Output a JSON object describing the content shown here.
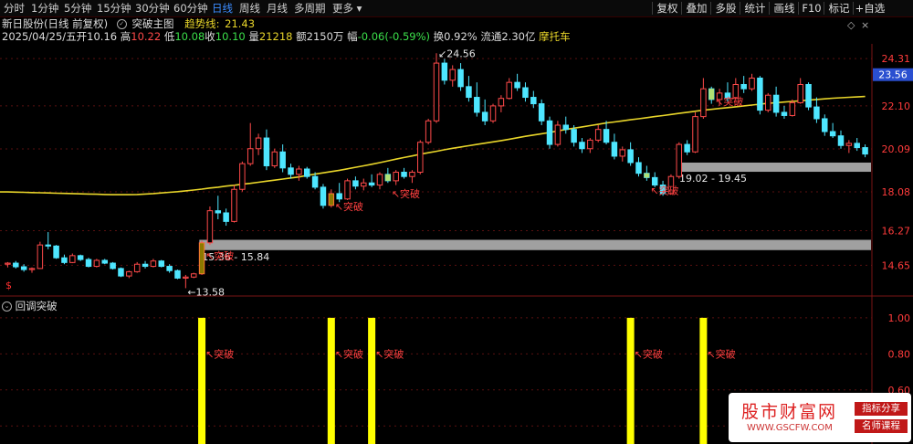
{
  "toolbar": {
    "periods": [
      "分时",
      "1分钟",
      "5分钟",
      "15分钟",
      "30分钟",
      "60分钟",
      "日线",
      "周线",
      "月线",
      "多周期",
      "更多"
    ],
    "active_period": "日线",
    "right_buttons": [
      "复权",
      "叠加",
      "多股",
      "统计",
      "画线",
      "F10",
      "标记",
      "+自选"
    ]
  },
  "header": {
    "stock": "新日股份(日线 前复权)",
    "indicator_name": "突破主图",
    "trend_label": "趋势线:",
    "trend_value": "21.43"
  },
  "quote": {
    "date": "2025/04/25/五",
    "open_label": "开",
    "open": "10.16",
    "high_label": "高",
    "high": "10.22",
    "low_label": "低",
    "low": "10.08",
    "close_label": "收",
    "close": "10.10",
    "vol_label": "量",
    "vol": "21218",
    "amount_label": "额",
    "amount": "2150万",
    "change_label": "幅",
    "change": "-0.06(-0.59%)",
    "turnover_label": "换",
    "turnover": "0.92%",
    "float_label": "流通",
    "float": "2.30亿",
    "sector": "摩托车"
  },
  "lower_panel": {
    "title": "回调突破"
  },
  "watermark": {
    "main": "股市财富网",
    "url": "WWW.GSCFW.COM",
    "tag1": "指标分享",
    "tag2": "名师课程"
  },
  "colors": {
    "up": "#ff4a4a",
    "down": "#4ee6ff",
    "ma": "#e8d52a",
    "band": "#a0a0a0",
    "signal_bar": "#ffff00",
    "axis_label": "#ff3b3b",
    "last_price_bg": "#2a4fd0"
  },
  "chart_data": {
    "type": "candlestick",
    "price_axis_ticks": [
      24.31,
      22.1,
      20.09,
      18.08,
      16.27,
      14.65
    ],
    "price_ylim": [
      13.3,
      25.0
    ],
    "last_price": "23.56",
    "candles": [
      [
        14.7,
        14.8,
        14.55,
        14.75
      ],
      [
        14.75,
        14.85,
        14.5,
        14.58
      ],
      [
        14.58,
        14.7,
        14.35,
        14.45
      ],
      [
        14.45,
        14.55,
        14.3,
        14.5
      ],
      [
        14.5,
        15.75,
        14.48,
        15.6
      ],
      [
        15.6,
        16.2,
        15.4,
        15.55
      ],
      [
        15.55,
        15.6,
        14.95,
        15.0
      ],
      [
        15.0,
        15.15,
        14.7,
        14.78
      ],
      [
        14.78,
        15.2,
        14.75,
        15.1
      ],
      [
        15.1,
        15.15,
        14.85,
        14.92
      ],
      [
        14.92,
        15.0,
        14.55,
        14.6
      ],
      [
        14.6,
        14.95,
        14.55,
        14.88
      ],
      [
        14.88,
        14.95,
        14.7,
        14.75
      ],
      [
        14.75,
        14.8,
        14.45,
        14.5
      ],
      [
        14.5,
        14.55,
        14.1,
        14.15
      ],
      [
        14.15,
        14.4,
        14.05,
        14.35
      ],
      [
        14.35,
        14.8,
        14.3,
        14.7
      ],
      [
        14.7,
        14.85,
        14.5,
        14.6
      ],
      [
        14.6,
        14.95,
        14.55,
        14.85
      ],
      [
        14.85,
        14.9,
        14.55,
        14.6
      ],
      [
        14.6,
        14.7,
        14.3,
        14.4
      ],
      [
        14.4,
        14.45,
        14.0,
        14.05
      ],
      [
        14.05,
        14.2,
        13.58,
        14.1
      ],
      [
        14.1,
        14.3,
        14.05,
        14.25
      ],
      [
        14.25,
        15.8,
        14.2,
        15.7
      ],
      [
        15.7,
        17.4,
        15.6,
        17.2
      ],
      [
        17.2,
        17.9,
        16.8,
        17.1
      ],
      [
        17.1,
        17.3,
        16.5,
        16.7
      ],
      [
        16.7,
        18.4,
        16.65,
        18.2
      ],
      [
        18.2,
        19.5,
        18.1,
        19.4
      ],
      [
        19.4,
        21.3,
        19.3,
        20.1
      ],
      [
        20.1,
        20.8,
        19.8,
        20.6
      ],
      [
        20.6,
        21.0,
        19.1,
        19.3
      ],
      [
        19.3,
        20.1,
        19.2,
        19.95
      ],
      [
        19.95,
        20.3,
        19.0,
        19.2
      ],
      [
        19.2,
        19.4,
        18.7,
        18.9
      ],
      [
        18.9,
        19.3,
        18.6,
        19.15
      ],
      [
        19.15,
        19.25,
        18.7,
        18.8
      ],
      [
        18.8,
        19.0,
        18.2,
        18.3
      ],
      [
        18.3,
        18.45,
        17.3,
        17.45
      ],
      [
        17.45,
        18.2,
        17.35,
        18.0
      ],
      [
        18.0,
        18.5,
        17.6,
        17.75
      ],
      [
        17.75,
        18.7,
        17.7,
        18.6
      ],
      [
        18.6,
        18.8,
        18.2,
        18.35
      ],
      [
        18.35,
        18.7,
        18.15,
        18.5
      ],
      [
        18.5,
        18.9,
        18.3,
        18.4
      ],
      [
        18.4,
        19.0,
        18.2,
        18.9
      ],
      [
        18.9,
        19.2,
        18.5,
        18.6
      ],
      [
        18.6,
        19.1,
        18.4,
        19.0
      ],
      [
        19.0,
        19.2,
        18.7,
        18.8
      ],
      [
        18.8,
        19.1,
        18.5,
        19.0
      ],
      [
        19.0,
        20.5,
        18.9,
        20.4
      ],
      [
        20.4,
        21.5,
        20.3,
        21.4
      ],
      [
        21.4,
        24.56,
        21.3,
        24.1
      ],
      [
        24.1,
        24.3,
        23.1,
        23.3
      ],
      [
        23.3,
        24.0,
        23.0,
        23.8
      ],
      [
        23.8,
        24.1,
        22.8,
        23.0
      ],
      [
        23.0,
        23.5,
        22.3,
        22.5
      ],
      [
        22.5,
        23.2,
        21.6,
        21.8
      ],
      [
        21.8,
        22.4,
        21.2,
        21.4
      ],
      [
        21.4,
        22.2,
        21.3,
        22.1
      ],
      [
        22.1,
        22.6,
        21.8,
        22.45
      ],
      [
        22.45,
        23.4,
        22.4,
        23.2
      ],
      [
        23.2,
        23.6,
        22.8,
        22.95
      ],
      [
        22.95,
        23.2,
        22.3,
        22.5
      ],
      [
        22.5,
        22.8,
        22.0,
        22.2
      ],
      [
        22.2,
        22.4,
        21.2,
        21.4
      ],
      [
        21.4,
        21.6,
        20.1,
        20.3
      ],
      [
        20.3,
        21.4,
        20.2,
        21.2
      ],
      [
        21.2,
        21.6,
        20.8,
        21.0
      ],
      [
        21.0,
        21.2,
        20.2,
        20.4
      ],
      [
        20.4,
        20.6,
        19.9,
        20.1
      ],
      [
        20.1,
        20.6,
        19.9,
        20.5
      ],
      [
        20.5,
        21.2,
        20.4,
        21.0
      ],
      [
        21.0,
        21.4,
        20.3,
        20.4
      ],
      [
        20.4,
        20.8,
        19.6,
        19.75
      ],
      [
        19.75,
        20.2,
        19.5,
        20.05
      ],
      [
        20.05,
        20.4,
        19.3,
        19.45
      ],
      [
        19.45,
        19.7,
        18.8,
        18.95
      ],
      [
        18.95,
        19.3,
        18.6,
        18.75
      ],
      [
        18.75,
        19.0,
        18.3,
        18.4
      ],
      [
        18.4,
        18.6,
        17.9,
        18.0
      ],
      [
        18.0,
        18.9,
        17.95,
        18.8
      ],
      [
        18.8,
        20.4,
        18.7,
        20.3
      ],
      [
        20.3,
        20.5,
        19.8,
        19.95
      ],
      [
        19.95,
        21.8,
        19.9,
        21.6
      ],
      [
        21.6,
        23.4,
        21.5,
        22.9
      ],
      [
        22.9,
        23.0,
        22.2,
        22.4
      ],
      [
        22.4,
        22.9,
        22.1,
        22.7
      ],
      [
        22.7,
        23.2,
        22.3,
        22.45
      ],
      [
        22.45,
        23.4,
        22.4,
        23.1
      ],
      [
        23.1,
        23.5,
        22.7,
        22.9
      ],
      [
        22.9,
        23.6,
        22.8,
        23.4
      ],
      [
        23.4,
        23.5,
        21.7,
        21.9
      ],
      [
        21.9,
        22.7,
        21.8,
        22.6
      ],
      [
        22.6,
        23.0,
        21.6,
        21.8
      ],
      [
        21.8,
        22.1,
        21.5,
        21.65
      ],
      [
        21.65,
        22.4,
        21.6,
        22.25
      ],
      [
        22.25,
        23.4,
        22.2,
        23.1
      ],
      [
        23.1,
        23.2,
        21.9,
        22.05
      ],
      [
        22.05,
        22.5,
        21.3,
        21.5
      ],
      [
        21.5,
        21.7,
        20.7,
        20.9
      ],
      [
        20.9,
        21.3,
        20.6,
        20.7
      ],
      [
        20.7,
        20.95,
        20.1,
        20.25
      ],
      [
        20.25,
        20.5,
        19.9,
        20.35
      ],
      [
        20.35,
        20.6,
        20.0,
        20.15
      ],
      [
        20.15,
        20.3,
        19.7,
        19.85
      ]
    ],
    "ma_series": [
      18.08,
      18.07,
      18.06,
      18.05,
      18.04,
      18.03,
      18.02,
      18.01,
      18.0,
      17.99,
      17.98,
      17.97,
      17.96,
      17.95,
      17.95,
      17.95,
      17.96,
      17.98,
      18.0,
      18.03,
      18.06,
      18.09,
      18.13,
      18.17,
      18.21,
      18.26,
      18.3,
      18.35,
      18.39,
      18.44,
      18.48,
      18.53,
      18.58,
      18.63,
      18.68,
      18.73,
      18.78,
      18.85,
      18.91,
      18.97,
      19.03,
      19.09,
      19.16,
      19.23,
      19.3,
      19.37,
      19.45,
      19.53,
      19.61,
      19.69,
      19.76,
      19.84,
      19.91,
      19.98,
      20.05,
      20.12,
      20.18,
      20.24,
      20.3,
      20.36,
      20.42,
      20.48,
      20.54,
      20.61,
      20.68,
      20.74,
      20.8,
      20.86,
      20.93,
      21.0,
      21.06,
      21.12,
      21.18,
      21.24,
      21.3,
      21.35,
      21.4,
      21.45,
      21.5,
      21.55,
      21.6,
      21.65,
      21.7,
      21.75,
      21.8,
      21.85,
      21.9,
      21.94,
      21.98,
      22.02,
      22.06,
      22.1,
      22.14,
      22.18,
      22.22,
      22.25,
      22.28,
      22.31,
      22.34,
      22.37,
      22.4,
      22.43,
      22.46,
      22.48,
      22.5,
      22.52,
      22.54,
      22.56,
      22.58,
      22.6,
      22.62,
      22.64,
      22.66,
      22.68,
      22.7,
      22.72,
      22.73,
      22.74,
      22.75,
      22.76,
      22.77,
      22.78,
      22.79,
      22.8,
      22.81,
      22.82,
      22.83,
      22.84,
      22.85,
      22.86,
      22.87,
      22.88,
      22.89,
      22.9,
      22.91,
      22.92,
      22.93,
      22.94,
      22.95,
      22.96,
      22.97,
      22.98,
      22.99,
      23.0,
      23.01,
      23.02,
      23.03,
      23.04,
      23.05,
      23.06,
      23.07,
      23.08,
      23.09,
      23.1,
      23.11,
      23.12,
      23.13,
      23.14,
      23.15,
      23.16,
      23.17,
      23.18,
      23.19,
      23.2,
      23.21,
      23.22,
      23.23,
      23.24,
      23.25,
      23.26,
      23.27,
      23.28,
      23.29,
      23.3,
      23.31,
      23.32,
      23.33,
      23.34,
      23.35,
      23.36,
      23.37,
      23.38,
      23.39,
      23.4,
      23.41,
      23.42,
      23.43,
      23.44,
      23.45,
      23.46,
      23.47,
      23.48,
      23.49,
      23.5,
      23.51,
      23.52,
      23.53,
      23.54,
      23.55,
      23.56
    ],
    "support_bands": [
      {
        "label": "15.36 - 15.84",
        "low": 15.36,
        "high": 15.84,
        "from_index": 24
      },
      {
        "label": "19.02 - 19.45",
        "low": 19.02,
        "high": 19.45,
        "from_index": 83
      }
    ],
    "price_labels": [
      {
        "text": "24.56",
        "index": 53,
        "price": 24.56
      },
      {
        "text": "13.58",
        "index": 22,
        "price": 13.58
      }
    ],
    "breakout_marks": [
      {
        "text": "突破",
        "index": 24,
        "price": 15.7
      },
      {
        "text": "突破",
        "index": 40,
        "price": 18.0
      },
      {
        "text": "突破",
        "index": 47,
        "price": 18.6
      },
      {
        "text": "突破",
        "index": 79,
        "price": 18.75
      },
      {
        "text": "突破",
        "index": 87,
        "price": 22.9
      }
    ],
    "signal_axis_ticks": [
      1.0,
      0.8,
      0.6,
      0.4
    ],
    "signal_ylim": [
      0.3,
      1.05
    ],
    "signals": [
      {
        "index": 24,
        "value": 1,
        "text": "突破"
      },
      {
        "index": 40,
        "value": 1,
        "text": "突破"
      },
      {
        "index": 45,
        "value": 1,
        "text": "突破"
      },
      {
        "index": 77,
        "value": 1,
        "text": "突破"
      },
      {
        "index": 86,
        "value": 1,
        "text": "突破"
      }
    ]
  }
}
